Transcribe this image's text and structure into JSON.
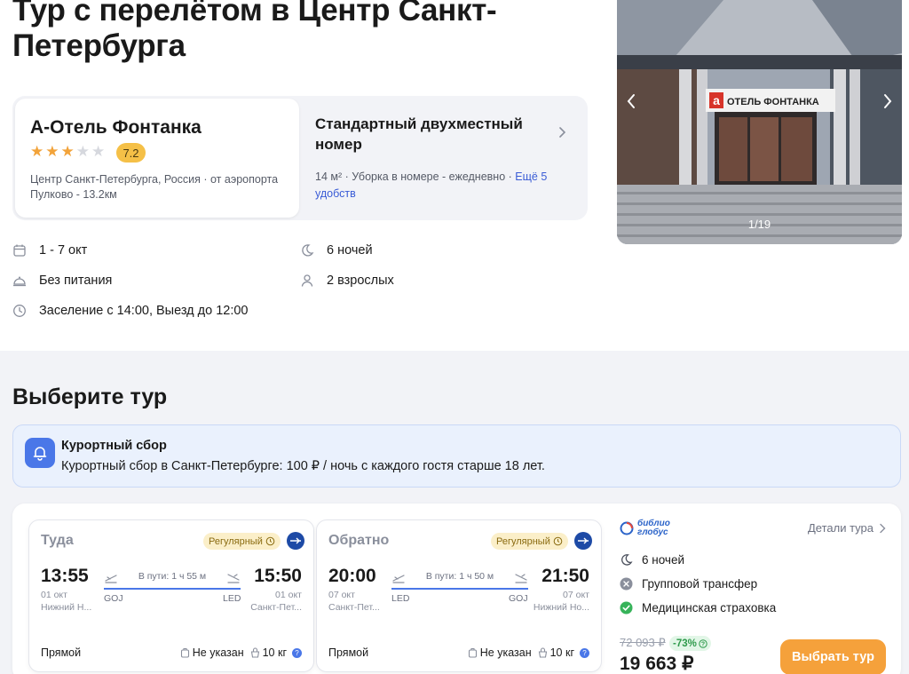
{
  "page": {
    "title": "Тур с перелётом в Центр Санкт-Петербурга"
  },
  "hotel": {
    "name": "А-Отель Фонтанка",
    "stars": 3,
    "stars_max": 5,
    "rating": "7.2",
    "location": "Центр Санкт-Петербурга, Россия · от аэропорта Пулково - 13.2км"
  },
  "room": {
    "title": "Стандартный двухместный номер",
    "meta": "14 м² · Уборка в номере - ежедневно · ",
    "more_link": "Ещё 5 удобств"
  },
  "gallery": {
    "counter": "1/19",
    "sign": "ОТЕЛЬ ФОНТАНКА",
    "sign_letter": "а"
  },
  "details": {
    "dates": "1 - 7 окт",
    "nights": "6 ночей",
    "meals": "Без питания",
    "guests": "2 взрослых",
    "checkin": "Заселение с 14:00, Выезд до 12:00"
  },
  "section": {
    "title": "Выберите тур"
  },
  "resort_fee": {
    "title": "Курортный сбор",
    "text": "Курортный сбор в Санкт-Петербурге: 100 ₽ / ночь с каждого гостя старше 18 лет."
  },
  "flights": [
    {
      "label": "Туда",
      "badge": "Регулярный",
      "dep_time": "13:55",
      "dep_date": "01 окт",
      "dep_city": "Нижний Н...",
      "dep_code": "GOJ",
      "duration": "В пути: 1 ч 55 м",
      "arr_time": "15:50",
      "arr_date": "01 окт",
      "arr_city": "Санкт-Пет...",
      "arr_code": "LED",
      "type": "Прямой",
      "baggage": "Не указан",
      "hand_baggage": "10 кг"
    },
    {
      "label": "Обратно",
      "badge": "Регулярный",
      "dep_time": "20:00",
      "dep_date": "07 окт",
      "dep_city": "Санкт-Пет...",
      "dep_code": "LED",
      "duration": "В пути: 1 ч 50 м",
      "arr_time": "21:50",
      "arr_date": "07 окт",
      "arr_city": "Нижний Но...",
      "arr_code": "GOJ",
      "type": "Прямой",
      "baggage": "Не указан",
      "hand_baggage": "10 кг"
    }
  ],
  "summary": {
    "operator_line1": "библио",
    "operator_line2": "глобус",
    "details_link": "Детали тура",
    "nights": "6 ночей",
    "transfer": "Групповой трансфер",
    "insurance": "Медицинская страховка",
    "old_price": "72 093 ₽",
    "discount": "-73%",
    "price": "19 663 ₽",
    "button": "Выбрать тур"
  },
  "colors": {
    "accent": "#4a77e8",
    "button": "#f5a13b",
    "star": "#f2a33a",
    "rating_badge": "#f5c047",
    "discount_green": "#2e9a4b"
  }
}
